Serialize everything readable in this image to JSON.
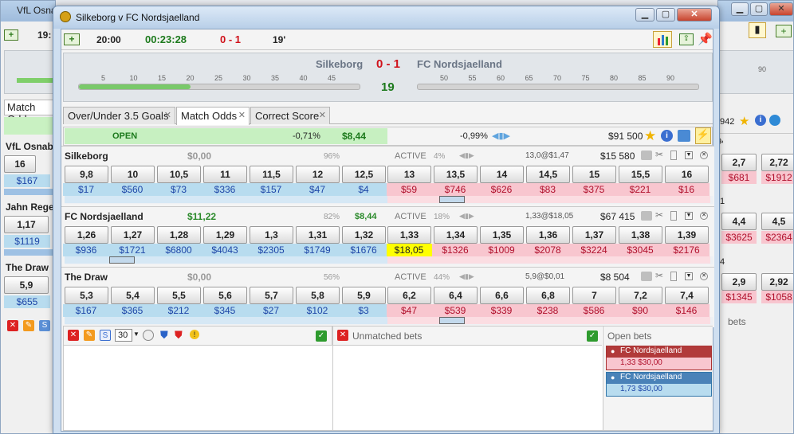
{
  "bg_left": {
    "title": "VfL Osnab",
    "time": "19:",
    "tab": "Match Odd",
    "rows": [
      {
        "name": "VfL Osnabr",
        "odd": "16",
        "money": "$167"
      },
      {
        "name": "Jahn Reger",
        "odd": "1,17",
        "money": "$1119"
      },
      {
        "name": "The Draw",
        "odd": "5,9",
        "money": "$655"
      }
    ]
  },
  "bg_right": {
    "rows": [
      {
        "odds": [
          "2,7",
          "2,72"
        ],
        "money": [
          "$681",
          "$1912"
        ]
      },
      {
        "odds": [
          "4,4",
          "4,5"
        ],
        "money": [
          "$3625",
          "$2364"
        ]
      },
      {
        "odds": [
          "2,9",
          "2,92"
        ],
        "money": [
          "$1345",
          "$1058"
        ]
      }
    ],
    "prefix": [
      "942",
      "1",
      "4"
    ],
    "bets_label": "bets",
    "ticks": [
      "90"
    ]
  },
  "window": {
    "title": "Silkeborg v FC Nordsjaelland"
  },
  "toolbar": {
    "kickoff": "20:00",
    "elapsed": "00:23:28",
    "score": "0 - 1",
    "minute": "19'"
  },
  "header": {
    "home": "Silkeborg",
    "score": "0 - 1",
    "away": "FC Nordsjaelland",
    "minute": "19",
    "ticks_left": [
      "5",
      "10",
      "15",
      "20",
      "25",
      "30",
      "35",
      "40",
      "45"
    ],
    "ticks_right": [
      "50",
      "55",
      "60",
      "65",
      "70",
      "75",
      "80",
      "85",
      "90"
    ]
  },
  "tabs": [
    {
      "label": "Over/Under 3.5 Goals"
    },
    {
      "label": "Match Odds"
    },
    {
      "label": "Correct Score"
    }
  ],
  "market": {
    "status": "OPEN",
    "back_pct": "-0,71%",
    "back_amount": "$8,44",
    "lay_pct": "-0,99%",
    "matched": "$91 500"
  },
  "runners": [
    {
      "name": "Silkeborg",
      "pl": "$0,00",
      "pl_color": "#999999",
      "back_pct": "96%",
      "status": "ACTIVE",
      "lay_pct": "4%",
      "last": "13,0@$1,47",
      "matched": "$15 580",
      "back_odds": [
        "9,8",
        "10",
        "10,5",
        "11",
        "11,5",
        "12",
        "12,5"
      ],
      "back_money": [
        "$17",
        "$560",
        "$73",
        "$336",
        "$157",
        "$47",
        "$4"
      ],
      "lay_odds": [
        "13",
        "13,5",
        "14",
        "14,5",
        "15",
        "15,5",
        "16"
      ],
      "lay_money": [
        "$59",
        "$746",
        "$626",
        "$83",
        "$375",
        "$221",
        "$16"
      ]
    },
    {
      "name": "FC Nordsjaelland",
      "pl": "$11,22",
      "pl_color": "#2a8a2a",
      "side_value": "$8,44",
      "back_pct": "82%",
      "status": "ACTIVE",
      "lay_pct": "18%",
      "last": "1,33@$18,05",
      "matched": "$67 415",
      "back_odds": [
        "1,26",
        "1,27",
        "1,28",
        "1,29",
        "1,3",
        "1,31",
        "1,32"
      ],
      "back_money": [
        "$936",
        "$1721",
        "$6800",
        "$4043",
        "$2305",
        "$1749",
        "$1676"
      ],
      "lay_odds": [
        "1,33",
        "1,34",
        "1,35",
        "1,36",
        "1,37",
        "1,38",
        "1,39"
      ],
      "lay_money": [
        "$18,05",
        "$1326",
        "$1009",
        "$2078",
        "$3224",
        "$3045",
        "$2176"
      ]
    },
    {
      "name": "The Draw",
      "pl": "$0,00",
      "pl_color": "#999999",
      "back_pct": "56%",
      "status": "ACTIVE",
      "lay_pct": "44%",
      "last": "5,9@$0,01",
      "matched": "$8 504",
      "back_odds": [
        "5,3",
        "5,4",
        "5,5",
        "5,6",
        "5,7",
        "5,8",
        "5,9"
      ],
      "back_money": [
        "$167",
        "$365",
        "$212",
        "$345",
        "$27",
        "$102",
        "$3"
      ],
      "lay_odds": [
        "6,2",
        "6,4",
        "6,6",
        "6,8",
        "7",
        "7,2",
        "7,4"
      ],
      "lay_money": [
        "$47",
        "$539",
        "$339",
        "$238",
        "$586",
        "$90",
        "$146"
      ]
    }
  ],
  "bottom": {
    "stake": "30",
    "unmatched_title": "Unmatched bets",
    "open_title": "Open bets",
    "open_bets": [
      {
        "runner": "FC Nordsjaelland",
        "detail": "1,33  $30,00",
        "type": "lay"
      },
      {
        "runner": "FC Nordsjaelland",
        "detail": "1,73  $30,00",
        "type": "back"
      }
    ]
  },
  "colors": {
    "back": "#b8dcef",
    "lay": "#f8c6cf",
    "highlight": "#ffff00",
    "score": "#d0121b",
    "elapsed": "#1d7a1d"
  }
}
